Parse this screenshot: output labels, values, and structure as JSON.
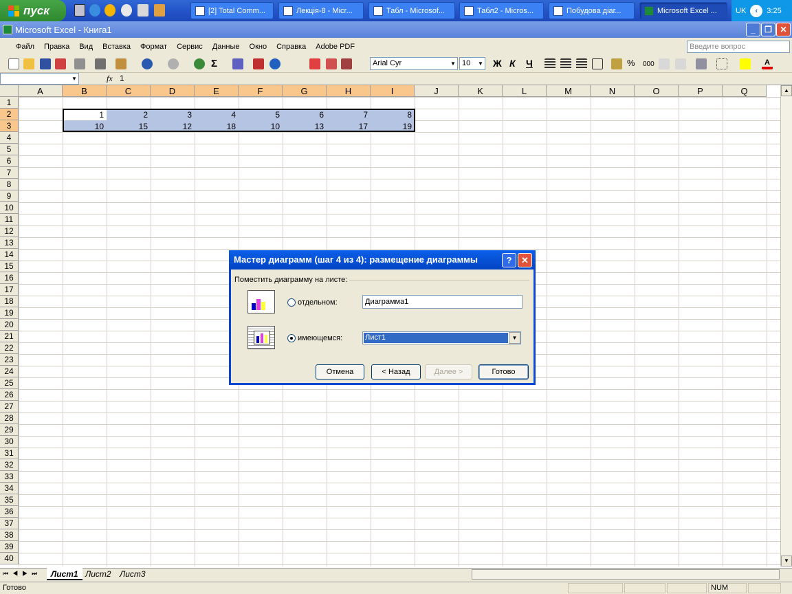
{
  "taskbar": {
    "start_label": "пуск",
    "buttons": [
      {
        "label": "[2] Total Comm..."
      },
      {
        "label": "Лекція-8 - Micr..."
      },
      {
        "label": "Табл - Microsof..."
      },
      {
        "label": "Табл2 - Micros..."
      },
      {
        "label": "Побудова діаг..."
      },
      {
        "label": "Microsoft Excel ..."
      }
    ],
    "lang": "UK",
    "clock": "3:25"
  },
  "window": {
    "title": "Microsoft Excel - Книга1"
  },
  "menubar": {
    "items": [
      "Файл",
      "Правка",
      "Вид",
      "Вставка",
      "Формат",
      "Сервис",
      "Данные",
      "Окно",
      "Справка",
      "Adobe PDF"
    ],
    "ask_placeholder": "Введите вопрос"
  },
  "toolbar": {
    "font_name": "Arial Cyr",
    "font_size": "10",
    "bold": "Ж",
    "italic": "К",
    "underline": "Ч",
    "percent": "%",
    "thousands": "000"
  },
  "formula": {
    "fx": "fx",
    "value": "1"
  },
  "grid": {
    "columns": [
      "A",
      "B",
      "C",
      "D",
      "E",
      "F",
      "G",
      "H",
      "I",
      "J",
      "K",
      "L",
      "M",
      "N",
      "O",
      "P",
      "Q"
    ],
    "rows": [
      "1",
      "2",
      "3",
      "4",
      "5",
      "6",
      "7",
      "8",
      "9",
      "10",
      "11",
      "12",
      "13",
      "14",
      "15",
      "16",
      "17",
      "18",
      "19",
      "20",
      "21",
      "22",
      "23",
      "24",
      "25",
      "26",
      "27",
      "28",
      "29",
      "30",
      "31",
      "32",
      "33",
      "34",
      "35",
      "36",
      "37",
      "38",
      "39",
      "40"
    ],
    "row2": [
      "1",
      "2",
      "3",
      "4",
      "5",
      "6",
      "7",
      "8"
    ],
    "row3": [
      "10",
      "15",
      "12",
      "18",
      "10",
      "13",
      "17",
      "19"
    ]
  },
  "sheet_tabs": [
    "Лист1",
    "Лист2",
    "Лист3"
  ],
  "status": {
    "ready": "Готово",
    "num": "NUM"
  },
  "dialog": {
    "title": "Мастер диаграмм (шаг 4 из 4): размещение диаграммы",
    "help": "?",
    "close": "✕",
    "group_label": "Поместить диаграмму на листе:",
    "option_separate": "отдельном:",
    "option_existing": "имеющемся:",
    "separate_name": "Диаграмма1",
    "existing_sheet": "Лист1",
    "btn_cancel": "Отмена",
    "btn_back": "< Назад",
    "btn_next": "Далее >",
    "btn_finish": "Готово"
  }
}
